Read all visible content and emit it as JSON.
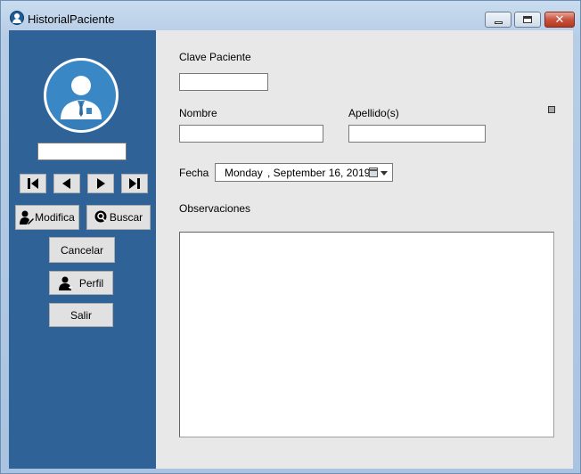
{
  "window": {
    "title": "HistorialPaciente",
    "icon": "patient-app-icon",
    "controls": [
      "minimize-icon",
      "maximize-icon",
      "close-icon"
    ]
  },
  "colors": {
    "sidebar": "#2f6398",
    "avatar_bg": "#3a87c5",
    "client_bg": "#e8e8e8",
    "button_bg": "#e1e1e1"
  },
  "sidebar": {
    "avatar_icon": "doctor-avatar-icon",
    "field_value": "",
    "nav_icons": [
      "first-record-icon",
      "previous-record-icon",
      "next-record-icon",
      "last-record-icon"
    ],
    "buttons": {
      "modifica": "Modifica",
      "buscar": "Buscar",
      "cancelar": "Cancelar",
      "perfil": "Perfil",
      "salir": "Salir"
    }
  },
  "form": {
    "clave_label": "Clave Paciente",
    "clave_value": "",
    "nombre_label": "Nombre",
    "nombre_value": "",
    "apellido_label": "Apellido(s)",
    "apellido_value": "",
    "fecha_label": "Fecha",
    "fecha_day": "Monday",
    "fecha_date": ", September 16, 2019",
    "observaciones_label": "Observaciones",
    "observaciones_value": ""
  }
}
